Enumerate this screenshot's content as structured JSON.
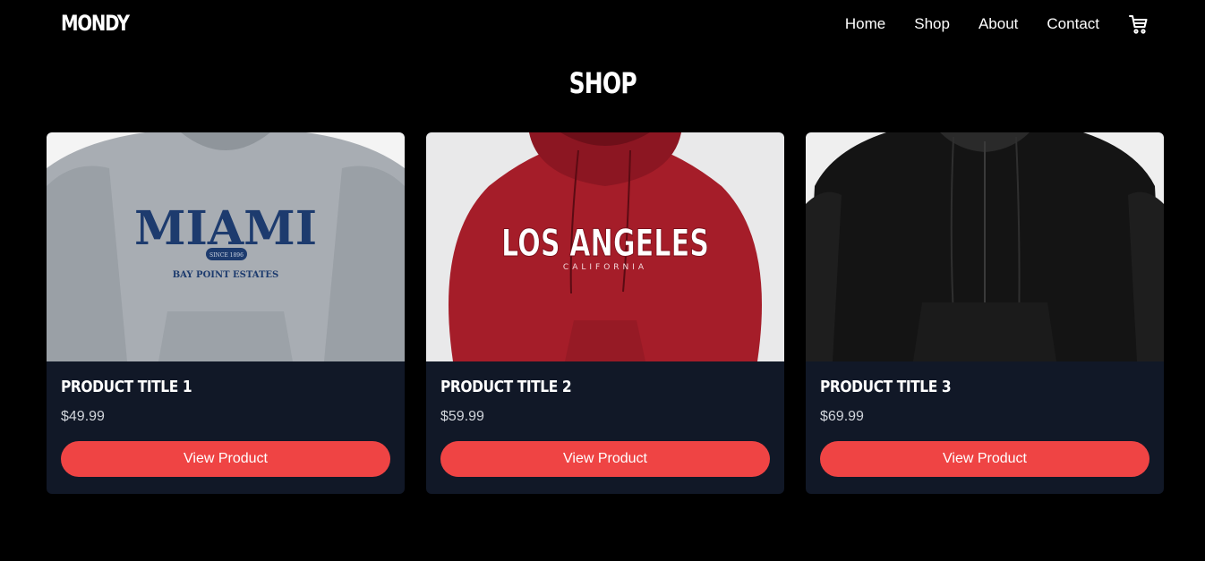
{
  "brand": {
    "logo": "MONDY"
  },
  "nav": {
    "links": [
      {
        "label": "Home"
      },
      {
        "label": "Shop"
      },
      {
        "label": "About"
      },
      {
        "label": "Contact"
      }
    ],
    "cart_icon": "shopping-cart-icon"
  },
  "page": {
    "title": "SHOP"
  },
  "products": [
    {
      "title": "PRODUCT TITLE 1",
      "price": "$49.99",
      "button": "View Product",
      "image": {
        "text1": "MIAMI",
        "text2": "SINCE 1896",
        "text3": "BAY POINT ESTATES",
        "color": "#a8adb3"
      }
    },
    {
      "title": "PRODUCT TITLE 2",
      "price": "$59.99",
      "button": "View Product",
      "image": {
        "text1": "LOS ANGELES",
        "text2": "CALIFORNIA",
        "color": "#a51d29"
      }
    },
    {
      "title": "PRODUCT TITLE 3",
      "price": "$69.99",
      "button": "View Product",
      "image": {
        "color": "#121212"
      }
    }
  ],
  "colors": {
    "background": "#000000",
    "card": "#111827",
    "accent": "#ef4444"
  }
}
